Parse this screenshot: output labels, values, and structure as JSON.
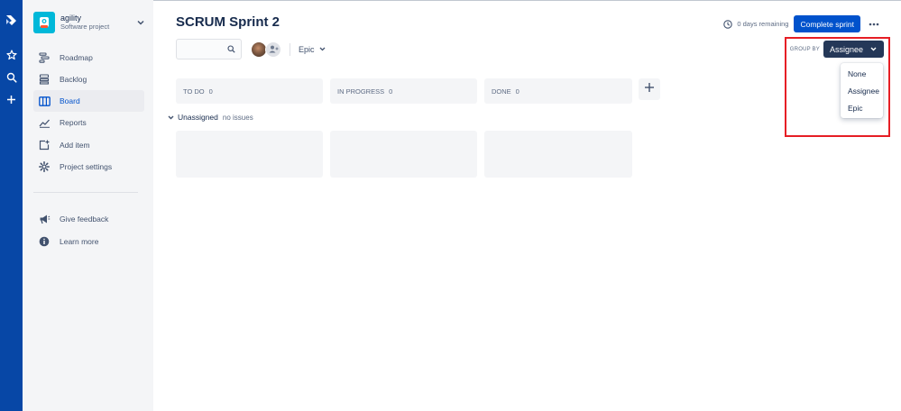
{
  "project": {
    "name": "agility",
    "type": "Software project"
  },
  "sidebar": {
    "items": [
      {
        "label": "Roadmap",
        "icon": "roadmap-icon"
      },
      {
        "label": "Backlog",
        "icon": "backlog-icon"
      },
      {
        "label": "Board",
        "icon": "board-icon",
        "active": true
      },
      {
        "label": "Reports",
        "icon": "reports-icon"
      },
      {
        "label": "Add item",
        "icon": "add-item-icon"
      },
      {
        "label": "Project settings",
        "icon": "gear-icon"
      }
    ],
    "footer_items": [
      {
        "label": "Give feedback",
        "icon": "megaphone-icon"
      },
      {
        "label": "Learn more",
        "icon": "info-icon"
      }
    ]
  },
  "header": {
    "title": "SCRUM Sprint 2",
    "days_remaining": "0 days remaining",
    "complete_sprint_label": "Complete sprint"
  },
  "toolbar": {
    "epic_filter_label": "Epic"
  },
  "group_by": {
    "label": "GROUP BY",
    "selected": "Assignee",
    "options": [
      "None",
      "Assignee",
      "Epic"
    ]
  },
  "columns": [
    {
      "name": "TO DO",
      "count": "0"
    },
    {
      "name": "IN PROGRESS",
      "count": "0"
    },
    {
      "name": "DONE",
      "count": "0"
    }
  ],
  "swimlane": {
    "name": "Unassigned",
    "note": "no issues"
  },
  "colors": {
    "global_nav": "#0747a6",
    "primary_button": "#0052cc",
    "group_button": "#253858",
    "highlight": "#e61e25",
    "sidebar_bg": "#f4f5f7"
  }
}
